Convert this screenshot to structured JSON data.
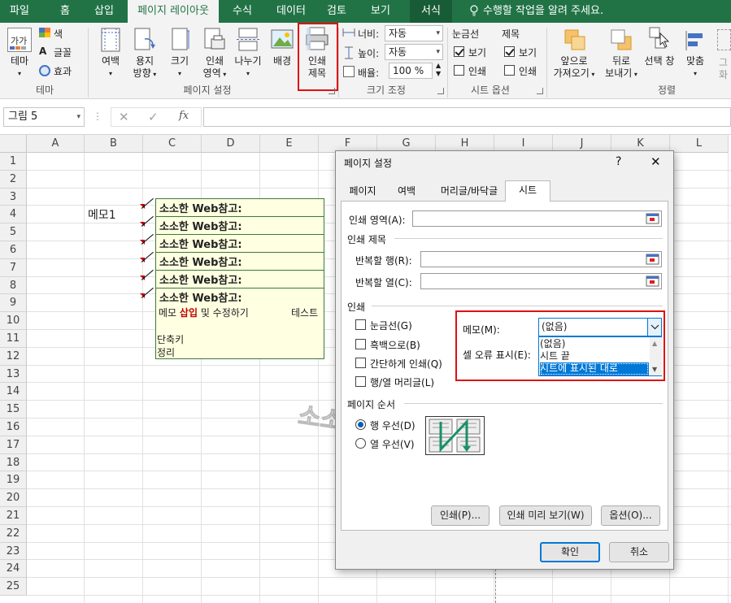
{
  "tabs": [
    {
      "label": "파일"
    },
    {
      "label": "홈"
    },
    {
      "label": "삽입"
    },
    {
      "label": "페이지 레이아웃"
    },
    {
      "label": "수식"
    },
    {
      "label": "데이터"
    },
    {
      "label": "검토"
    },
    {
      "label": "보기"
    },
    {
      "label": "서식"
    }
  ],
  "tell_me": "수행할 작업을 알려 주세요.",
  "ribbon": {
    "theme": {
      "label": "테마",
      "colors": "색",
      "fonts": "글꼴",
      "effects": "효과",
      "group": "테마"
    },
    "page_setup": {
      "margins": "여백",
      "orientation1": "용지",
      "orientation2": "방향",
      "size": "크기",
      "print_area1": "인쇄",
      "print_area2": "영역",
      "breaks": "나누기",
      "background": "배경",
      "print_titles1": "인쇄",
      "print_titles2": "제목",
      "group": "페이지 설정"
    },
    "scale": {
      "width_label": "너비:",
      "width_value": "자동",
      "height_label": "높이:",
      "height_value": "자동",
      "scale_label": "배율:",
      "scale_value": "100 %",
      "group": "크기 조정"
    },
    "sheet_options": {
      "gridlines": "눈금선",
      "headings": "제목",
      "view1": "보기",
      "print1": "인쇄",
      "view2": "보기",
      "print2": "인쇄",
      "group": "시트 옵션"
    },
    "arrange": {
      "bring_forward1": "앞으로",
      "bring_forward2": "가져오기",
      "send_backward1": "뒤로",
      "send_backward2": "보내기",
      "selection_pane": "선택 창",
      "align": "맞춤",
      "group1": "그",
      "group2": "화",
      "group": "정렬"
    }
  },
  "formula_bar": {
    "name_box": "그림 5",
    "fx": "fx"
  },
  "columns": [
    "A",
    "B",
    "C",
    "D",
    "E",
    "F",
    "G",
    "H",
    "I",
    "J",
    "K",
    "L"
  ],
  "rows": [
    "1",
    "2",
    "3",
    "4",
    "5",
    "6",
    "7",
    "8",
    "9",
    "10",
    "11",
    "12",
    "13",
    "14",
    "15",
    "16",
    "17",
    "18",
    "19",
    "20",
    "21",
    "22",
    "23",
    "24",
    "25"
  ],
  "cells": {
    "b4": "메모1"
  },
  "memos": [
    {
      "title": "소소한 Web참고:"
    },
    {
      "title": "소소한 Web참고:"
    },
    {
      "title": "소소한 Web참고:"
    },
    {
      "title": "소소한 Web참고:"
    },
    {
      "title": "소소한 Web참고:"
    },
    {
      "title": "소소한 Web참고:"
    }
  ],
  "memo_body": {
    "line1_a": "메모 ",
    "line1_b": "삽입",
    "line1_c": " 및 수정하기",
    "line1_d": "테스트",
    "line3": "단축키",
    "line4": "정리"
  },
  "watermark": "소소",
  "dialog": {
    "title": "페이지 설정",
    "help": "?",
    "close": "✕",
    "tabs": [
      {
        "label": "페이지"
      },
      {
        "label": "여백"
      },
      {
        "label": "머리글/바닥글"
      },
      {
        "label": "시트"
      }
    ],
    "print_area": "인쇄 영역(A):",
    "print_titles": "인쇄 제목",
    "rows_repeat": "반복할 행(R):",
    "cols_repeat": "반복할 열(C):",
    "print_section": "인쇄",
    "gridlines": "눈금선(G)",
    "bw": "흑백으로(B)",
    "draft": "간단하게 인쇄(Q)",
    "headings": "행/열 머리글(L)",
    "comments_label": "메모(M):",
    "comments_value": "(없음)",
    "errors_label": "셀 오류 표시(E):",
    "comments_options": [
      "(없음)",
      "시트 끝",
      "시트에 표시된 대로"
    ],
    "page_order": "페이지 순서",
    "down_then_over": "행 우선(D)",
    "over_then_down": "열 우선(V)",
    "print_btn": "인쇄(P)...",
    "preview_btn": "인쇄 미리 보기(W)",
    "options_btn": "옵션(O)...",
    "ok": "확인",
    "cancel": "취소"
  },
  "colors": {
    "accent": "#217346",
    "highlight": "#e01010",
    "selected": "#0078d7"
  }
}
